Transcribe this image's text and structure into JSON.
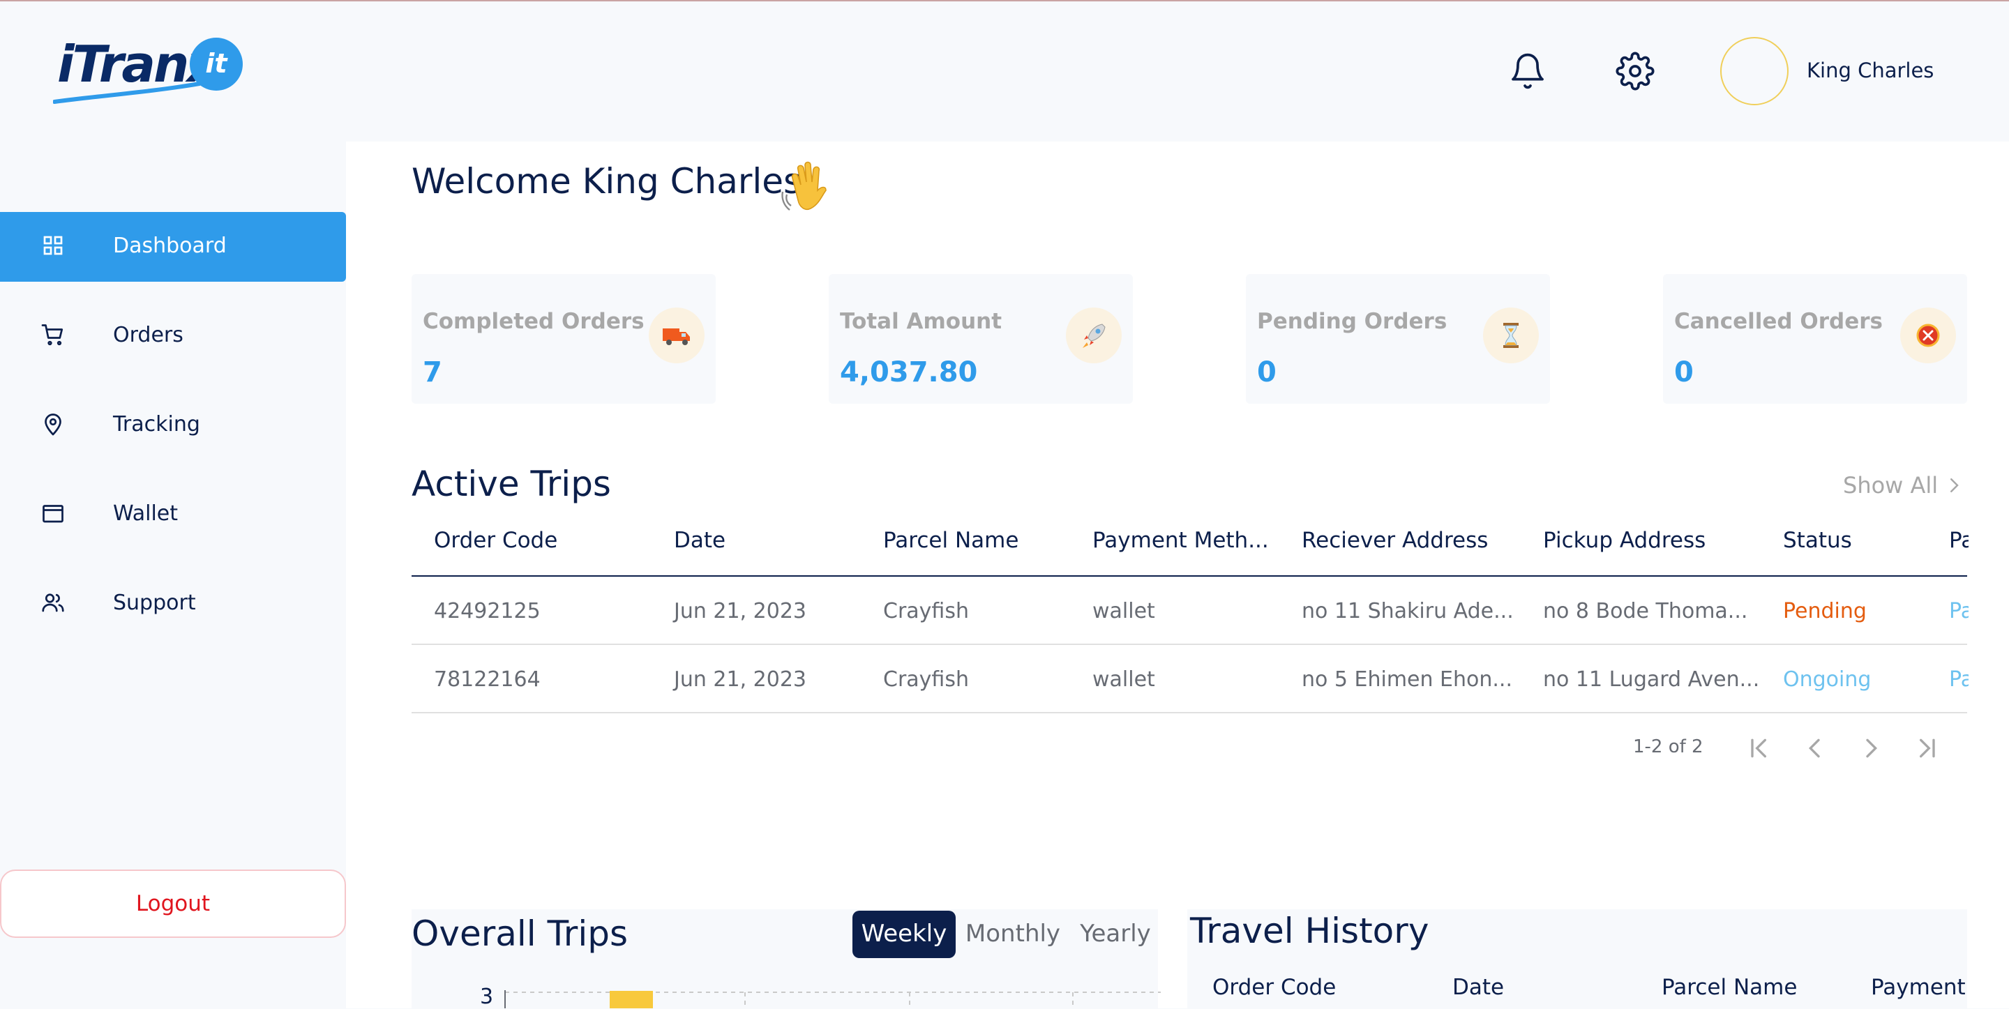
{
  "brand": {
    "logo_text": "iTranx",
    "logo_badge": "it"
  },
  "header": {
    "username": "King Charles"
  },
  "sidebar": {
    "items": [
      {
        "label": "Dashboard",
        "icon": "grid-icon",
        "active": true
      },
      {
        "label": "Orders",
        "icon": "cart-icon"
      },
      {
        "label": "Tracking",
        "icon": "location-pin-icon"
      },
      {
        "label": "Wallet",
        "icon": "wallet-icon"
      },
      {
        "label": "Support",
        "icon": "users-icon"
      }
    ],
    "logout_label": "Logout"
  },
  "main": {
    "welcome": "Welcome King Charles",
    "stats": [
      {
        "label": "Completed Orders",
        "value": "7",
        "icon": "truck-icon"
      },
      {
        "label": "Total Amount",
        "value": "4,037.80",
        "icon": "rocket-icon"
      },
      {
        "label": "Pending Orders",
        "value": "0",
        "icon": "hourglass-icon"
      },
      {
        "label": "Cancelled Orders",
        "value": "0",
        "icon": "cancel-icon"
      }
    ],
    "active_trips": {
      "title": "Active Trips",
      "show_all": "Show All",
      "columns": [
        "Order Code",
        "Date",
        "Parcel Name",
        "Payment Meth...",
        "Reciever Address",
        "Pickup Address",
        "Status",
        "Pa"
      ],
      "rows": [
        [
          "42492125",
          "Jun 21, 2023",
          "Crayfish",
          "wallet",
          "no 11 Shakiru Ade...",
          "no 8 Bode Thoma...",
          "Pending",
          "Pa"
        ],
        [
          "78122164",
          "Jun 21, 2023",
          "Crayfish",
          "wallet",
          "no 5 Ehimen Ehon...",
          "no 11 Lugard Aven...",
          "Ongoing",
          "Pa"
        ]
      ],
      "pagination": "1-2 of 2"
    },
    "overall_trips": {
      "title": "Overall Trips",
      "tabs": [
        "Weekly",
        "Monthly",
        "Yearly"
      ],
      "active_tab": "Weekly",
      "y_tick_label": "3"
    },
    "travel_history": {
      "title": "Travel History",
      "columns": [
        "Order Code",
        "Date",
        "Parcel Name",
        "Payment I"
      ]
    }
  },
  "colors": {
    "accent": "#2f9bea",
    "navy": "#0c1f4b",
    "pending": "#e45c0f",
    "ongoing": "#6ec2ef",
    "logout": "#e0151e",
    "bar": "#f8c93c"
  }
}
